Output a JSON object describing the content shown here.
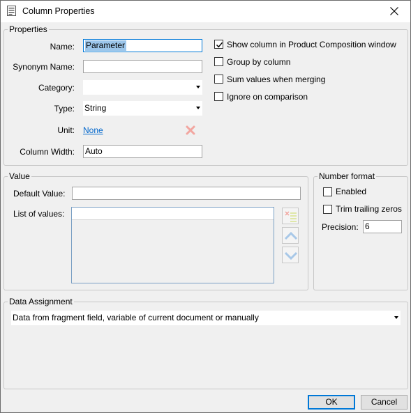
{
  "window": {
    "title": "Column Properties",
    "title_icon": "document-properties-icon",
    "close_icon": "close-icon"
  },
  "properties": {
    "group_label": "Properties",
    "name_label": "Name:",
    "name_value": "Parameter",
    "synonym_label": "Synonym Name:",
    "synonym_value": "",
    "category_label": "Category:",
    "category_value": "",
    "type_label": "Type:",
    "type_value": "String",
    "unit_label": "Unit:",
    "unit_value": "None",
    "column_width_label": "Column Width:",
    "column_width_value": "Auto",
    "options": [
      {
        "label": "Show column in Product Composition window",
        "checked": true
      },
      {
        "label": "Group by column",
        "checked": false
      },
      {
        "label": "Sum values when merging",
        "checked": false
      },
      {
        "label": "Ignore on comparison",
        "checked": false
      }
    ]
  },
  "value": {
    "group_label": "Value",
    "default_label": "Default Value:",
    "default_value": "",
    "list_label": "List of values:"
  },
  "number_format": {
    "group_label": "Number format",
    "enabled_label": "Enabled",
    "enabled_checked": false,
    "trim_label": "Trim trailing zeros",
    "trim_checked": false,
    "precision_label": "Precision:",
    "precision_value": "6"
  },
  "data_assignment": {
    "group_label": "Data Assignment",
    "selected": "Data from fragment field, variable of current document or manually"
  },
  "buttons": {
    "ok": "OK",
    "cancel": "Cancel"
  },
  "colors": {
    "link": "#0066cc",
    "selection": "#9cc6eb",
    "clear_icon": "#f2a6a0",
    "arrow_icons": "#a8c8e8"
  }
}
